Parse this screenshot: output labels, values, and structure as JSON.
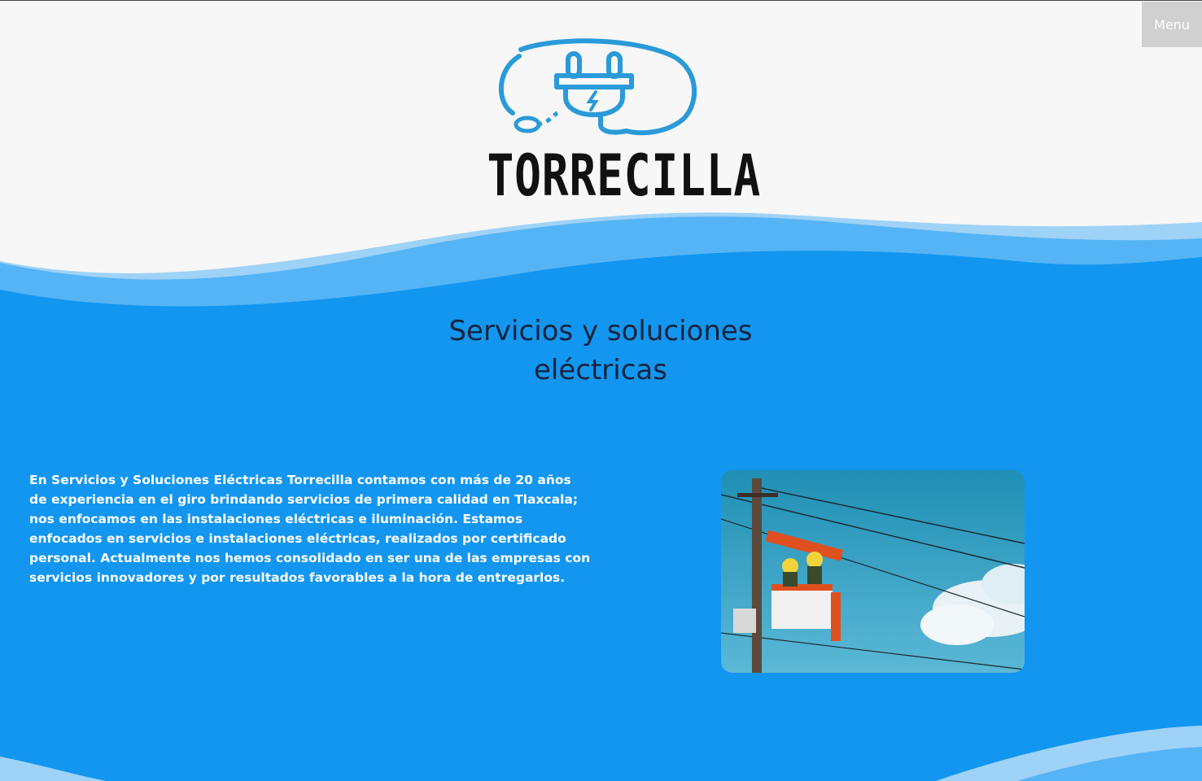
{
  "header": {
    "menu_label": "Menu",
    "logo_text": "TORRECILLA"
  },
  "hero": {
    "title_line1": "Servicios y soluciones",
    "title_line2": "eléctricas"
  },
  "intro": {
    "paragraph": "En Servicios y Soluciones Eléctricas Torrecilla contamos con más de 20 años de experiencia en el giro brindando servicios de primera calidad en Tlaxcala; nos enfocamos en las instalaciones eléctricas e iluminación. Estamos enfocados en servicios e instalaciones eléctricas, realizados por certificado personal. Actualmente nos hemos consolidado en ser una de las empresas con servicios innovadores y por resultados favorables a la hora de entregarlos."
  },
  "colors": {
    "primary_blue": "#1296f0",
    "light_blue": "#55b4f5",
    "header_bg": "#f7f7f7",
    "logo_blue": "#2a9ad8",
    "menu_bg": "#d0d0d0"
  },
  "icons": {
    "logo": "electric-plug-icon",
    "menu": "menu-button"
  }
}
